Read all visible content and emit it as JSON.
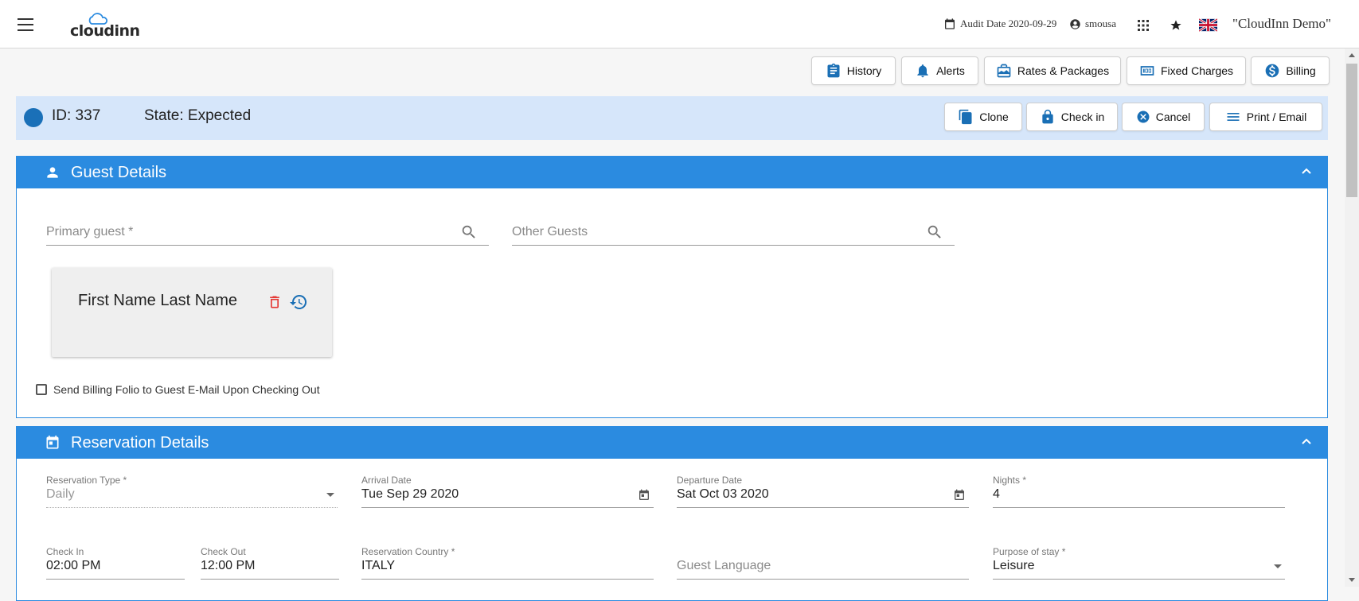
{
  "topbar": {
    "brand": "cloudinn",
    "audit_date": "Audit Date 2020-09-29",
    "user": "smousa",
    "company": "\"CloudInn Demo\""
  },
  "toolbar": {
    "history": "History",
    "alerts": "Alerts",
    "rates_packages": "Rates & Packages",
    "fixed_charges": "Fixed Charges",
    "billing": "Billing"
  },
  "reservation": {
    "id_label": "ID: 337",
    "state_label": "State: Expected",
    "actions": {
      "clone": "Clone",
      "check_in": "Check in",
      "cancel": "Cancel",
      "print_email": "Print / Email"
    }
  },
  "guest_details": {
    "title": "Guest Details",
    "primary_guest_placeholder": "Primary guest *",
    "other_guests_placeholder": "Other Guests",
    "guest_card_name": "First Name Last Name",
    "send_folio_label": "Send Billing Folio to Guest E-Mail Upon Checking Out"
  },
  "reservation_details": {
    "title": "Reservation Details",
    "reservation_type": {
      "label": "Reservation Type *",
      "value": "Daily"
    },
    "arrival_date": {
      "label": "Arrival Date",
      "value": "Tue Sep 29 2020"
    },
    "departure_date": {
      "label": "Departure Date",
      "value": "Sat Oct 03 2020"
    },
    "nights": {
      "label": "Nights *",
      "value": "4"
    },
    "check_in": {
      "label": "Check In",
      "value": "02:00 PM"
    },
    "check_out": {
      "label": "Check Out",
      "value": "12:00 PM"
    },
    "reservation_country": {
      "label": "Reservation Country *",
      "value": "ITALY"
    },
    "guest_language": {
      "placeholder": "Guest Language"
    },
    "purpose_of_stay": {
      "label": "Purpose of stay *",
      "value": "Leisure"
    }
  },
  "colors": {
    "primary": "#2b8be0",
    "state_bar": "#d6e6fa",
    "icon_blue": "#1a6fb5",
    "delete_red": "#e53935"
  }
}
